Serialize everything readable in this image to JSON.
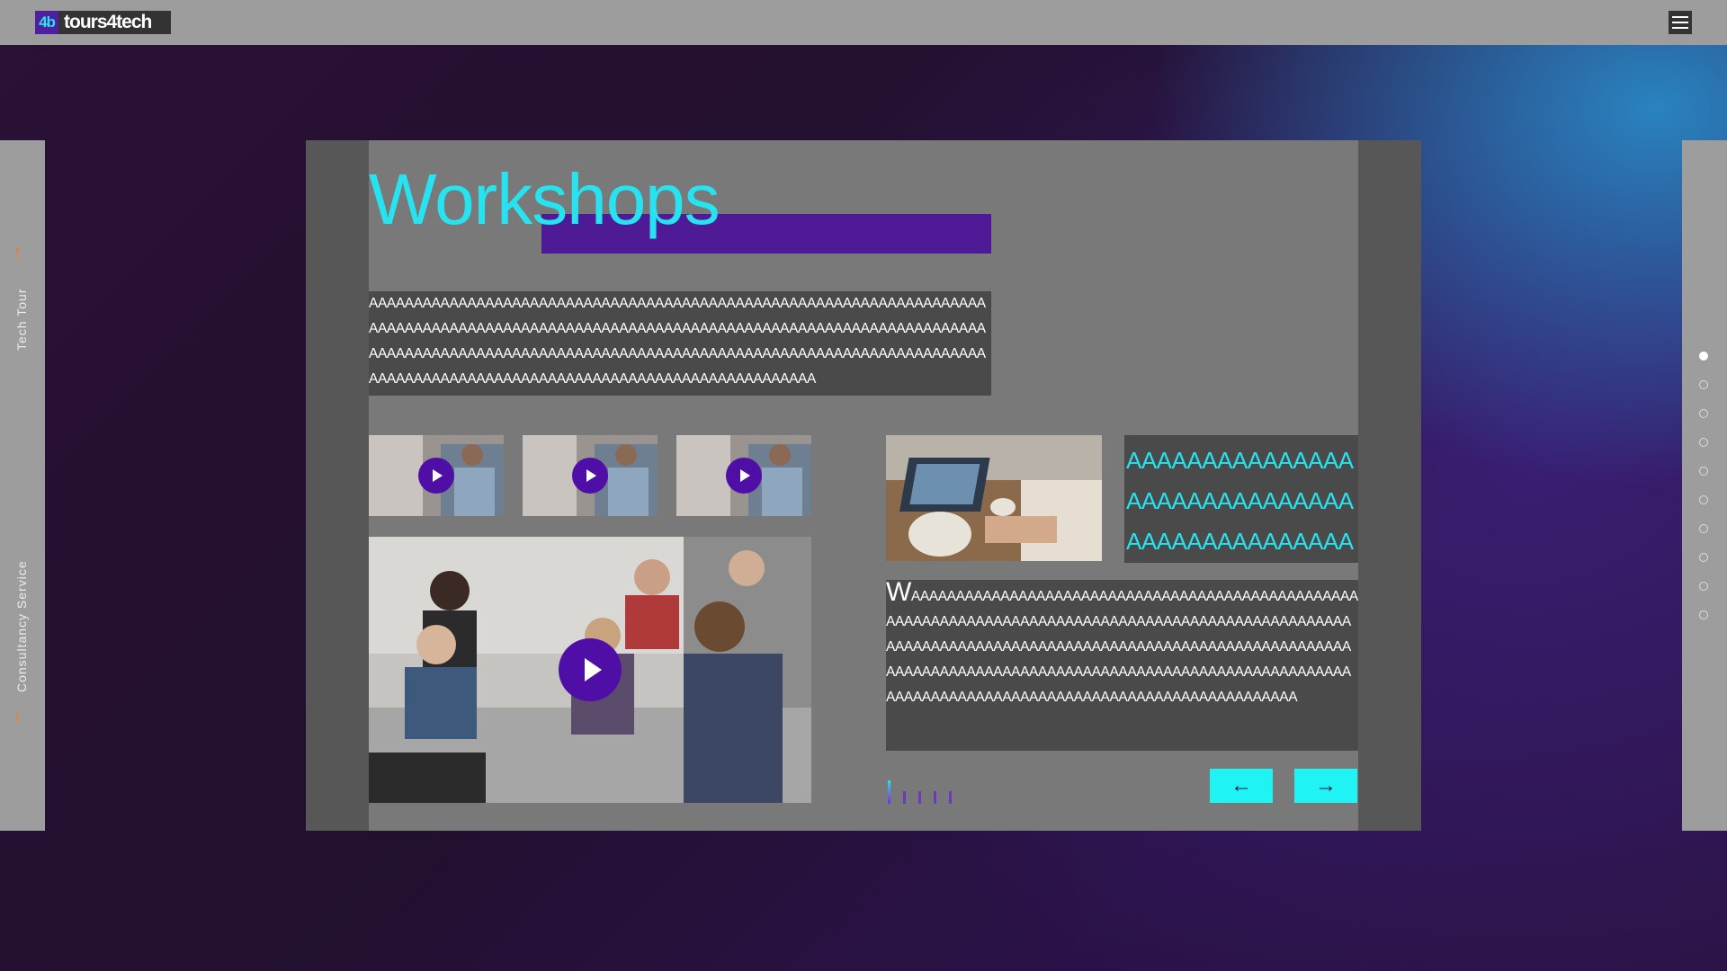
{
  "header": {
    "logo_mark": "4b",
    "logo_text": "tours4tech",
    "menu_icon": "hamburger-icon"
  },
  "left_rail": {
    "up_label": "Tech Tour",
    "down_label": "Consultancy Service",
    "up_icon": "arrow-up-icon",
    "down_icon": "arrow-down-icon"
  },
  "right_rail": {
    "dots": 10,
    "active_index": 0
  },
  "main": {
    "title": "Workshops",
    "paragraph": "AAAAAAAAAAAAAAAAAAAAAAAAAAAAAAAAAAAAAAAAAAAAAAAAAAAAAAAAAAAAAAAAAAAAAAAAAAAAAAAAAAAAAAAAAAAAAAAAAAAAAAAAAAAAAAAAAAAAAAAAAAAAAAAAAAAAAAAAAAAAAAAAAAAAAAAAAAAAAAAAAAAAAAAAAAAAAAAAAAAAAAAAAAAAAAAAAAAAAAAAAAAAAAAAAAAAAAAAAAAAAAAAAAAAAAAAAAAAAAAAAAAAAAAAAAAAAAAAA",
    "cyan_lines": [
      "AAAAAAAAAAAAAAA",
      "AAAAAAAAAAAAAAA",
      "AAAAAAAAAAAAAAA"
    ],
    "desc_initial": "W",
    "desc_text": "AAAAAAAAAAAAAAAAAAAAAAAAAAAAAAAAAAAAAAAAAAAAAAAAAAAAAAAAAAAAAAAAAAAAAAAAAAAAAAAAAAAAAAAAAAAAAAAAAAAAAAAAAAAAAAAAAAAAAAAAAAAAAAAAAAAAAAAAAAAAAAAAAAAAAAAAAAAAAAAAAAAAAAAAAAAAAAAAAAAAAAAAAAAAAAAAAAAAAAAAAAAAAAAAAAAAAAAAAAAAAAAAAAAAAAAAAAAAAAAAAAAAAAAAAAAA",
    "thumbnails": 3,
    "pager_count": 5,
    "pager_active": 0,
    "prev_label": "←",
    "next_label": "→"
  },
  "colors": {
    "accent_cyan": "#27e3f0",
    "accent_purple": "#4f1a96",
    "nav_orange": "#f57d20"
  }
}
